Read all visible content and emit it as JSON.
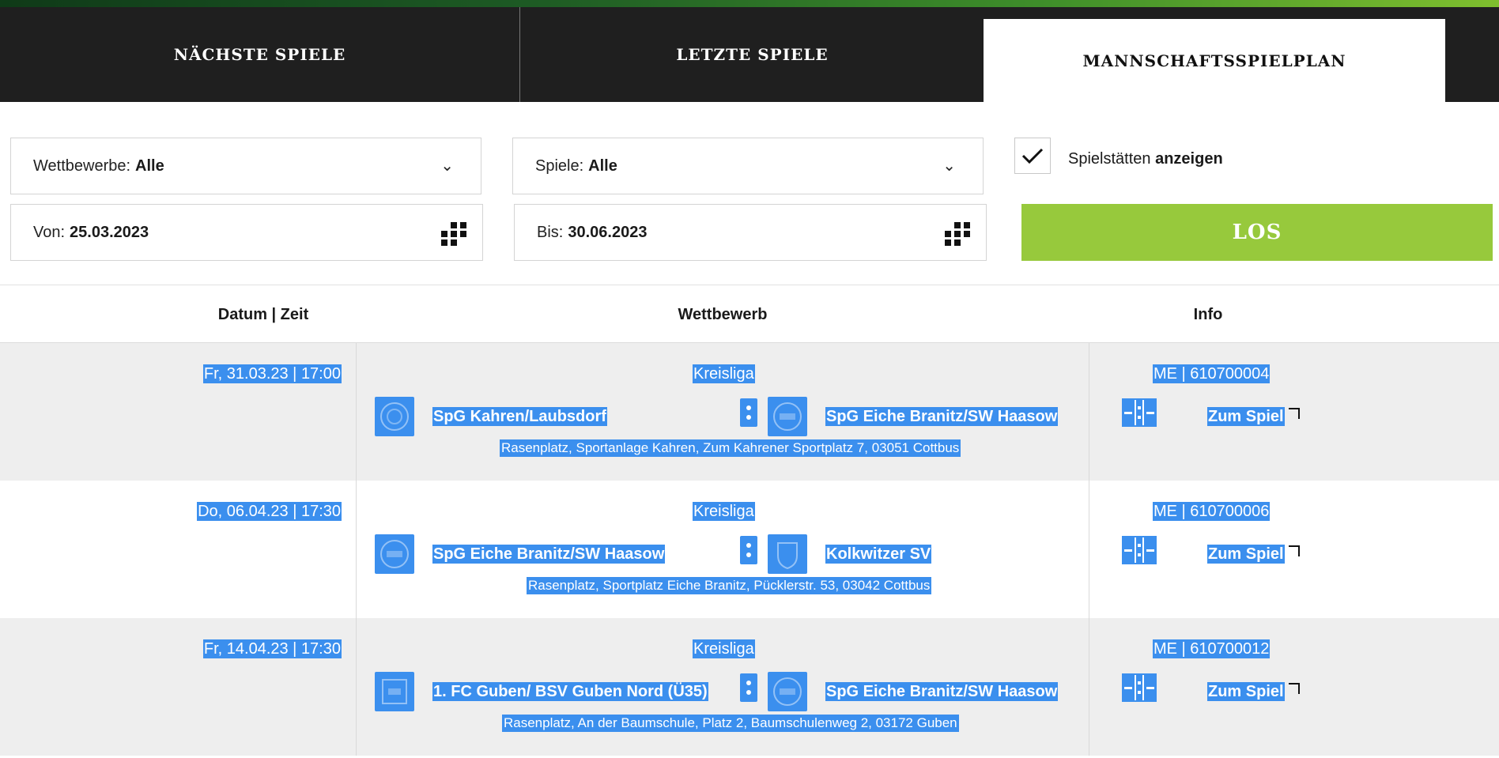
{
  "tabs": {
    "next": "NÄCHSTE SPIELE",
    "last": "LETZTE SPIELE",
    "schedule": "MANNSCHAFTSSPIELPLAN"
  },
  "filters": {
    "competitions": {
      "label": "Wettbewerbe:",
      "value": "Alle"
    },
    "games": {
      "label": "Spiele:",
      "value": "Alle"
    },
    "from": {
      "label": "Von:",
      "value": "25.03.2023"
    },
    "to": {
      "label": "Bis:",
      "value": "30.06.2023"
    },
    "show_venues": {
      "label_prefix": "Spielstätten",
      "label_bold": "anzeigen",
      "checked": true
    },
    "go_label": "LOS"
  },
  "table": {
    "headers": {
      "date": "Datum | Zeit",
      "competition": "Wettbewerb",
      "info": "Info"
    },
    "rows": [
      {
        "date": "Fr, 31.03.23 | 17:00",
        "competition": "Kreisliga",
        "home": "SpG Kahren/Laubsdorf",
        "away": "SpG Eiche Branitz/SW Haasow",
        "venue": "Rasenplatz, Sportanlage Kahren, Zum Kahrener Sportplatz 7, 03051 Cottbus",
        "match_id": "ME | 610700004",
        "link": "Zum Spiel"
      },
      {
        "date": "Do, 06.04.23 | 17:30",
        "competition": "Kreisliga",
        "home": "SpG Eiche Branitz/SW Haasow",
        "away": "Kolkwitzer SV",
        "venue": "Rasenplatz, Sportplatz Eiche Branitz, Pücklerstr. 53, 03042 Cottbus",
        "match_id": "ME | 610700006",
        "link": "Zum Spiel"
      },
      {
        "date": "Fr, 14.04.23 | 17:30",
        "competition": "Kreisliga",
        "home": "1. FC Guben/ BSV Guben Nord (Ü35)",
        "away": "SpG Eiche Branitz/SW Haasow",
        "venue": "Rasenplatz, An der Baumschule, Platz 2, Baumschulenweg 2, 03172 Guben",
        "match_id": "ME | 610700012",
        "link": "Zum Spiel"
      }
    ]
  },
  "colors": {
    "accent_green": "#97c93c",
    "selection_blue": "#3b8fee",
    "tabbar": "#1f1f1f"
  }
}
